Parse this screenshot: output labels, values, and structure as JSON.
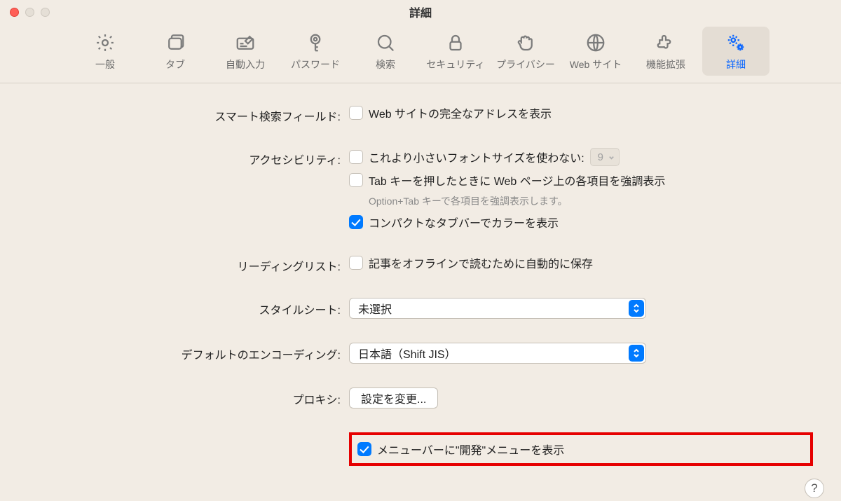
{
  "window_title": "詳細",
  "toolbar": {
    "items": [
      {
        "label": "一般",
        "icon": "gear-icon"
      },
      {
        "label": "タブ",
        "icon": "tabs-icon"
      },
      {
        "label": "自動入力",
        "icon": "autofill-icon"
      },
      {
        "label": "パスワード",
        "icon": "key-icon"
      },
      {
        "label": "検索",
        "icon": "search-icon"
      },
      {
        "label": "セキュリティ",
        "icon": "lock-icon"
      },
      {
        "label": "プライバシー",
        "icon": "hand-icon"
      },
      {
        "label": "Web サイト",
        "icon": "globe-icon"
      },
      {
        "label": "機能拡張",
        "icon": "puzzle-icon"
      },
      {
        "label": "詳細",
        "icon": "gears-icon"
      }
    ],
    "active_index": 9
  },
  "sections": {
    "smart_search": {
      "label": "スマート検索フィールド:",
      "checkbox_label": "Web サイトの完全なアドレスを表示",
      "checked": false
    },
    "accessibility": {
      "label": "アクセシビリティ:",
      "font_checkbox_label": "これより小さいフォントサイズを使わない:",
      "font_checked": false,
      "font_size_value": "9",
      "tab_checkbox_label": "Tab キーを押したときに Web ページ上の各項目を強調表示",
      "tab_checked": false,
      "tab_hint": "Option+Tab キーで各項目を強調表示します。",
      "compact_checkbox_label": "コンパクトなタブバーでカラーを表示",
      "compact_checked": true
    },
    "reading_list": {
      "label": "リーディングリスト:",
      "checkbox_label": "記事をオフラインで読むために自動的に保存",
      "checked": false
    },
    "stylesheet": {
      "label": "スタイルシート:",
      "value": "未選択"
    },
    "encoding": {
      "label": "デフォルトのエンコーディング:",
      "value": "日本語（Shift JIS）"
    },
    "proxy": {
      "label": "プロキシ:",
      "button_label": "設定を変更..."
    },
    "develop": {
      "checkbox_label": "メニューバーに\"開発\"メニューを表示",
      "checked": true
    }
  },
  "help_label": "?"
}
